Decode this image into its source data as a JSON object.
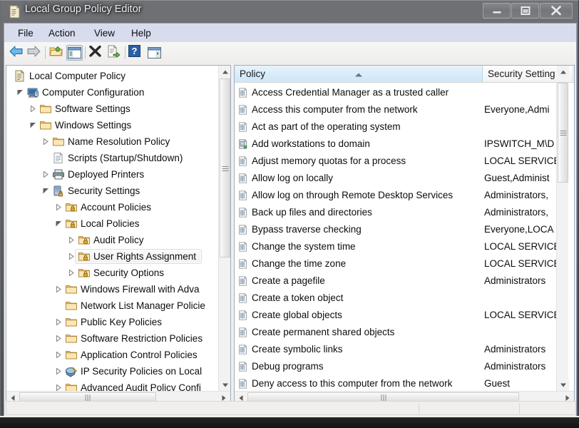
{
  "window": {
    "title": "Local Group Policy Editor",
    "icon": "policy-document-icon",
    "minimize_label": "Minimize",
    "maximize_label": "Maximize",
    "close_label": "Close"
  },
  "menubar": {
    "items": [
      {
        "label": "File"
      },
      {
        "label": "Action"
      },
      {
        "label": "View"
      },
      {
        "label": "Help"
      }
    ]
  },
  "toolbar": {
    "buttons": [
      {
        "name": "back-icon",
        "label": "Back"
      },
      {
        "name": "forward-icon",
        "label": "Forward"
      },
      {
        "name": "up-folder-icon",
        "label": "Up One Level"
      },
      {
        "name": "show-hide-tree-icon",
        "label": "Show/Hide Console Tree"
      },
      {
        "name": "delete-icon",
        "label": "Delete"
      },
      {
        "name": "export-list-icon",
        "label": "Export List"
      },
      {
        "name": "help-icon",
        "label": "Help"
      },
      {
        "name": "properties-icon",
        "label": "Properties"
      }
    ]
  },
  "tree": {
    "nodes": [
      {
        "label": "Local Computer Policy",
        "depth": 0,
        "icon": "policy-document-icon",
        "twisty": "none",
        "selected": false
      },
      {
        "label": "Computer Configuration",
        "depth": 1,
        "icon": "computer-icon",
        "twisty": "expanded",
        "selected": false
      },
      {
        "label": "Software Settings",
        "depth": 2,
        "icon": "folder-icon",
        "twisty": "collapsed",
        "selected": false
      },
      {
        "label": "Windows Settings",
        "depth": 2,
        "icon": "folder-icon",
        "twisty": "expanded",
        "selected": false
      },
      {
        "label": "Name Resolution Policy",
        "depth": 3,
        "icon": "folder-icon",
        "twisty": "collapsed",
        "selected": false
      },
      {
        "label": "Scripts (Startup/Shutdown)",
        "depth": 3,
        "icon": "script-icon",
        "twisty": "none",
        "selected": false
      },
      {
        "label": "Deployed Printers",
        "depth": 3,
        "icon": "printer-icon",
        "twisty": "collapsed",
        "selected": false
      },
      {
        "label": "Security Settings",
        "depth": 3,
        "icon": "security-lock-icon",
        "twisty": "expanded",
        "selected": false
      },
      {
        "label": "Account Policies",
        "depth": 4,
        "icon": "folder-lock-icon",
        "twisty": "collapsed",
        "selected": false
      },
      {
        "label": "Local Policies",
        "depth": 4,
        "icon": "folder-lock-icon",
        "twisty": "expanded",
        "selected": false
      },
      {
        "label": "Audit Policy",
        "depth": 5,
        "icon": "folder-lock-icon",
        "twisty": "collapsed",
        "selected": false
      },
      {
        "label": "User Rights Assignment",
        "depth": 5,
        "icon": "folder-lock-icon",
        "twisty": "collapsed",
        "selected": true
      },
      {
        "label": "Security Options",
        "depth": 5,
        "icon": "folder-lock-icon",
        "twisty": "collapsed",
        "selected": false
      },
      {
        "label": "Windows Firewall with Adva",
        "depth": 4,
        "icon": "folder-icon",
        "twisty": "collapsed",
        "selected": false
      },
      {
        "label": "Network List Manager Policie",
        "depth": 4,
        "icon": "folder-icon",
        "twisty": "none",
        "selected": false
      },
      {
        "label": "Public Key Policies",
        "depth": 4,
        "icon": "folder-icon",
        "twisty": "collapsed",
        "selected": false
      },
      {
        "label": "Software Restriction Policies",
        "depth": 4,
        "icon": "folder-icon",
        "twisty": "collapsed",
        "selected": false
      },
      {
        "label": "Application Control Policies",
        "depth": 4,
        "icon": "folder-icon",
        "twisty": "collapsed",
        "selected": false
      },
      {
        "label": "IP Security Policies on Local",
        "depth": 4,
        "icon": "ip-security-icon",
        "twisty": "collapsed",
        "selected": false
      },
      {
        "label": "Advanced Audit Policy Confi",
        "depth": 4,
        "icon": "folder-icon",
        "twisty": "collapsed",
        "selected": false
      }
    ]
  },
  "list": {
    "columns": [
      {
        "label": "Policy",
        "sorted": true,
        "sort_direction": "ascending"
      },
      {
        "label": "Security Setting",
        "sorted": false,
        "sort_direction": ""
      }
    ],
    "rows": [
      {
        "policy": "Access Credential Manager as a trusted caller",
        "setting": "",
        "icon": "policy-setting-icon"
      },
      {
        "policy": "Access this computer from the network",
        "setting": "Everyone,Admi",
        "icon": "policy-setting-icon"
      },
      {
        "policy": "Act as part of the operating system",
        "setting": "",
        "icon": "policy-setting-icon"
      },
      {
        "policy": "Add workstations to domain",
        "setting": "IPSWITCH_M\\D",
        "icon": "policy-domain-icon"
      },
      {
        "policy": "Adjust memory quotas for a process",
        "setting": "LOCAL SERVICE",
        "icon": "policy-setting-icon"
      },
      {
        "policy": "Allow log on locally",
        "setting": "Guest,Administ",
        "icon": "policy-setting-icon"
      },
      {
        "policy": "Allow log on through Remote Desktop Services",
        "setting": "Administrators,",
        "icon": "policy-setting-icon"
      },
      {
        "policy": "Back up files and directories",
        "setting": "Administrators,",
        "icon": "policy-setting-icon"
      },
      {
        "policy": "Bypass traverse checking",
        "setting": "Everyone,LOCA",
        "icon": "policy-setting-icon"
      },
      {
        "policy": "Change the system time",
        "setting": "LOCAL SERVICE",
        "icon": "policy-setting-icon"
      },
      {
        "policy": "Change the time zone",
        "setting": "LOCAL SERVICE",
        "icon": "policy-setting-icon"
      },
      {
        "policy": "Create a pagefile",
        "setting": "Administrators",
        "icon": "policy-setting-icon"
      },
      {
        "policy": "Create a token object",
        "setting": "",
        "icon": "policy-setting-icon"
      },
      {
        "policy": "Create global objects",
        "setting": "LOCAL SERVICE",
        "icon": "policy-setting-icon"
      },
      {
        "policy": "Create permanent shared objects",
        "setting": "",
        "icon": "policy-setting-icon"
      },
      {
        "policy": "Create symbolic links",
        "setting": "Administrators",
        "icon": "policy-setting-icon"
      },
      {
        "policy": "Debug programs",
        "setting": "Administrators",
        "icon": "policy-setting-icon"
      },
      {
        "policy": "Deny access to this computer from the network",
        "setting": "Guest",
        "icon": "policy-setting-icon"
      }
    ]
  },
  "colors": {
    "titlebar": "#5e6064",
    "menubar": "#d8dced",
    "sorted_column": "#d7ebf9",
    "pane_background": "#ffffff",
    "client_background": "#f0efed"
  }
}
